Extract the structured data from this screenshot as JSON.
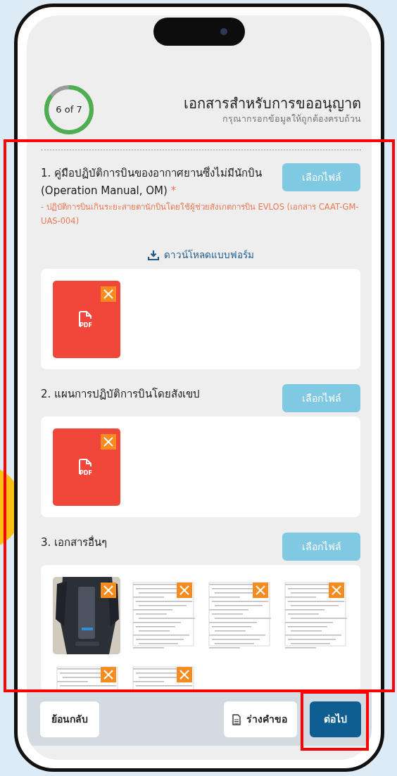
{
  "progress": {
    "label": "6 of 7",
    "level": 0.857
  },
  "header": {
    "title": "เอกสารสำหรับการขออนุญาต",
    "subtitle": "กรุณากรอกข้อมูลให้ถูกต้องครบถ้วน"
  },
  "sections": [
    {
      "title": "1. คู่มือปฏิบัติการบินของอากาศยานซึ่งไม่มีนักบิน (Operation Manual, OM)",
      "required_mark": "*",
      "note": "- ปฏิบัติการบินเกินระยะสายตานักบินโดยใช้ผู้ช่วยสังเกตการบิน EVLOS (เอกสาร CAAT-GM-UAS-004)",
      "download_link": "ดาวน์โหลดแบบฟอร์ม",
      "button": "เลือกไฟล์",
      "files": [
        {
          "kind": "pdf",
          "label": "PDF"
        }
      ]
    },
    {
      "title": "2. แผนการปฏิบัติการบินโดยสังเขป",
      "button": "เลือกไฟล์",
      "files": [
        {
          "kind": "pdf",
          "label": "PDF"
        }
      ]
    },
    {
      "title": "3. เอกสารอื่นๆ",
      "button": "เลือกไฟล์",
      "files": [
        {
          "kind": "picture"
        },
        {
          "kind": "document"
        },
        {
          "kind": "document"
        },
        {
          "kind": "document"
        },
        {
          "kind": "document"
        },
        {
          "kind": "document"
        }
      ]
    }
  ],
  "content_highlighted": true,
  "footer": {
    "back_button": "ย้อนกลับ",
    "draft_button": "ร่างคำขอ",
    "next_button": "ต่อไป",
    "next_highlighted": true
  }
}
